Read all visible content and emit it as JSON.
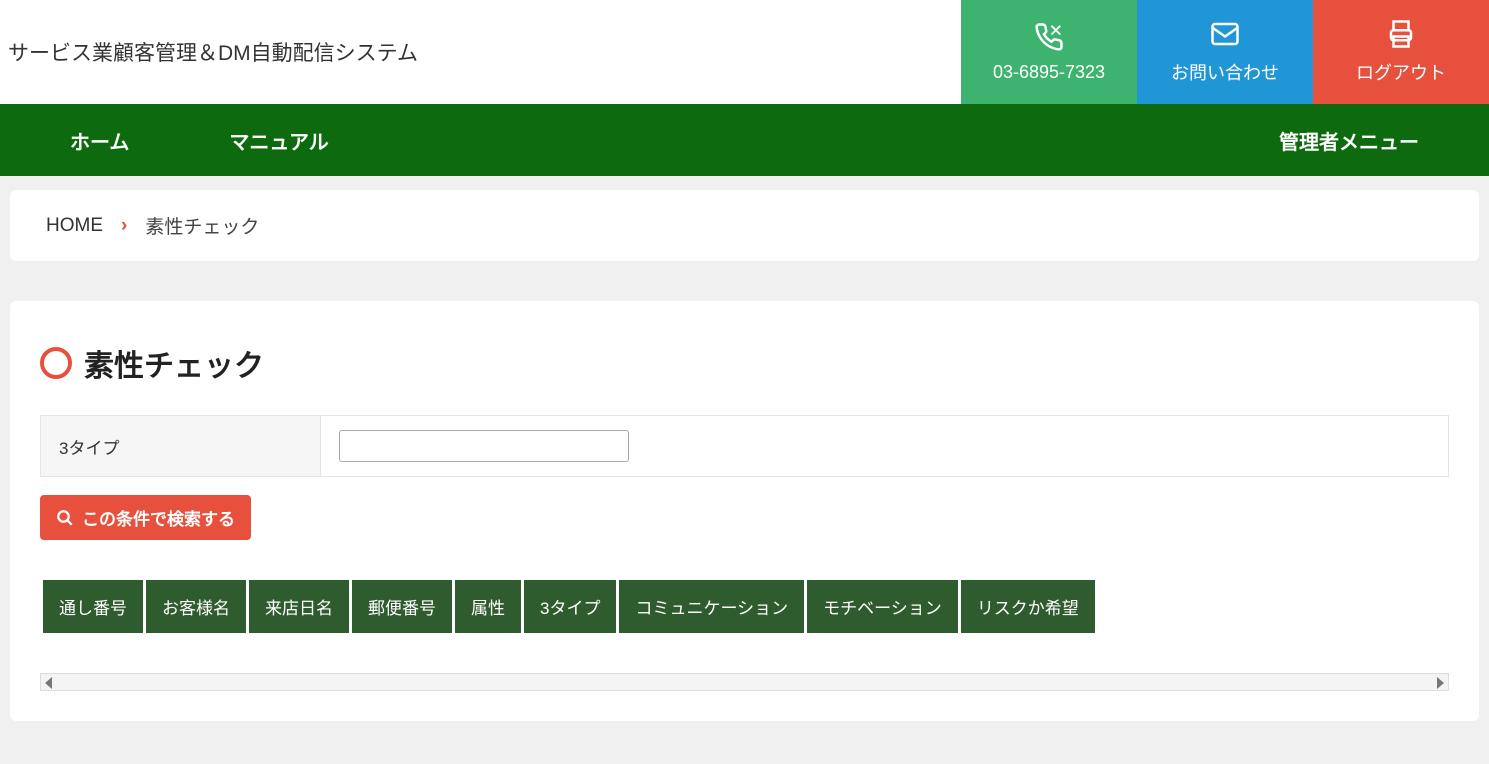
{
  "header": {
    "title": "サービス業顧客管理＆DM自動配信システム",
    "phone": "03-6895-7323",
    "contact": "お問い合わせ",
    "logout": "ログアウト"
  },
  "nav": {
    "home": "ホーム",
    "manual": "マニュアル",
    "admin": "管理者メニュー"
  },
  "breadcrumb": {
    "home": "HOME",
    "current": "素性チェック"
  },
  "page": {
    "title": "素性チェック",
    "filter_label": "3タイプ",
    "filter_value": "",
    "search_btn": "この条件で検索する"
  },
  "columns": [
    "通し番号",
    "お客様名",
    "来店日名",
    "郵便番号",
    "属性",
    "3タイプ",
    "コミュニケーション",
    "モチベーション",
    "リスクか希望"
  ]
}
